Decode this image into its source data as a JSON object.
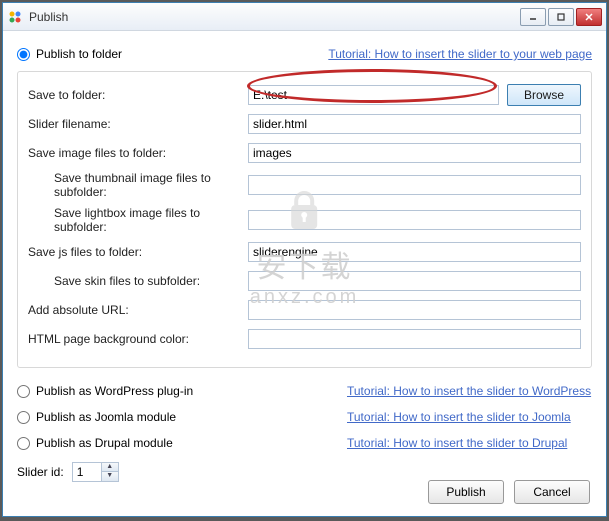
{
  "window": {
    "title": "Publish"
  },
  "topRadio": {
    "label": "Publish to folder",
    "tutorial": "Tutorial: How to insert the slider to your web page"
  },
  "fields": {
    "saveFolder": {
      "label": "Save to folder:",
      "value": "E:\\test",
      "browse": "Browse"
    },
    "sliderFilename": {
      "label": "Slider filename:",
      "value": "slider.html"
    },
    "saveImages": {
      "label": "Save image files to folder:",
      "value": "images"
    },
    "thumbSub": {
      "label": "Save thumbnail image files to subfolder:",
      "value": ""
    },
    "lightboxSub": {
      "label": "Save lightbox image files to subfolder:",
      "value": ""
    },
    "saveJs": {
      "label": "Save js files to folder:",
      "value": "sliderengine"
    },
    "skinSub": {
      "label": "Save skin files to subfolder:",
      "value": ""
    },
    "absUrl": {
      "label": "Add absolute URL:",
      "value": ""
    },
    "bgColor": {
      "label": "HTML page background color:",
      "value": ""
    }
  },
  "publishOptions": {
    "wordpress": {
      "label": "Publish as WordPress plug-in",
      "tutorial": "Tutorial: How to insert the slider to WordPress"
    },
    "joomla": {
      "label": "Publish as Joomla module",
      "tutorial": "Tutorial: How to insert the slider to Joomla"
    },
    "drupal": {
      "label": "Publish as Drupal module",
      "tutorial": "Tutorial: How to insert the slider to Drupal"
    }
  },
  "sliderId": {
    "label": "Slider id:",
    "value": "1"
  },
  "buttons": {
    "publish": "Publish",
    "cancel": "Cancel"
  },
  "watermark": {
    "cn": "安下载",
    "en": "anxz.com"
  }
}
